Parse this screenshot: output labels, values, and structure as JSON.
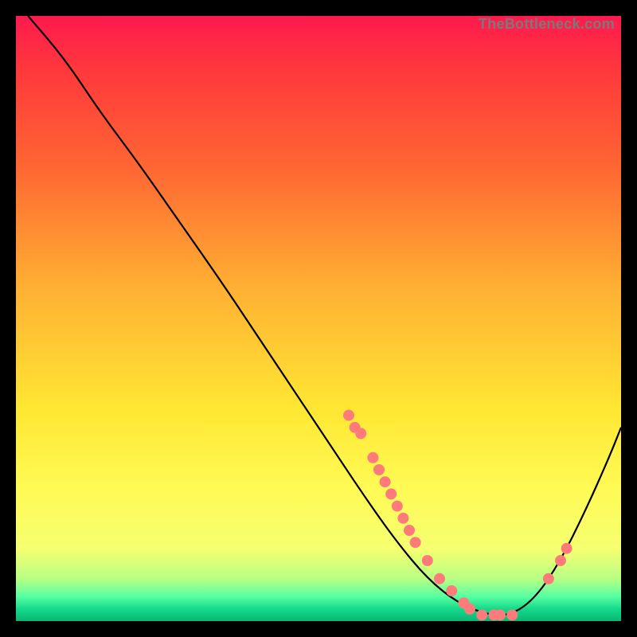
{
  "watermark": "TheBottleneck.com",
  "chart_data": {
    "type": "line",
    "title": "",
    "xlabel": "",
    "ylabel": "",
    "xlim": [
      0,
      100
    ],
    "ylim": [
      0,
      100
    ],
    "grid": false,
    "curve": [
      {
        "x": 2,
        "y": 100
      },
      {
        "x": 8,
        "y": 93
      },
      {
        "x": 14,
        "y": 84
      },
      {
        "x": 20,
        "y": 76
      },
      {
        "x": 27,
        "y": 66
      },
      {
        "x": 34,
        "y": 56
      },
      {
        "x": 40,
        "y": 47
      },
      {
        "x": 46,
        "y": 38
      },
      {
        "x": 52,
        "y": 29
      },
      {
        "x": 58,
        "y": 20
      },
      {
        "x": 63,
        "y": 13
      },
      {
        "x": 68,
        "y": 7
      },
      {
        "x": 73,
        "y": 3
      },
      {
        "x": 78,
        "y": 1
      },
      {
        "x": 82,
        "y": 1
      },
      {
        "x": 86,
        "y": 4
      },
      {
        "x": 90,
        "y": 10
      },
      {
        "x": 94,
        "y": 18
      },
      {
        "x": 98,
        "y": 27
      },
      {
        "x": 100,
        "y": 32
      }
    ],
    "points": [
      {
        "x": 55,
        "y": 34
      },
      {
        "x": 56,
        "y": 32
      },
      {
        "x": 57,
        "y": 31
      },
      {
        "x": 59,
        "y": 27
      },
      {
        "x": 60,
        "y": 25
      },
      {
        "x": 61,
        "y": 23
      },
      {
        "x": 62,
        "y": 21
      },
      {
        "x": 63,
        "y": 19
      },
      {
        "x": 64,
        "y": 17
      },
      {
        "x": 65,
        "y": 15
      },
      {
        "x": 66,
        "y": 13
      },
      {
        "x": 68,
        "y": 10
      },
      {
        "x": 70,
        "y": 7
      },
      {
        "x": 72,
        "y": 5
      },
      {
        "x": 74,
        "y": 3
      },
      {
        "x": 75,
        "y": 2
      },
      {
        "x": 77,
        "y": 1
      },
      {
        "x": 79,
        "y": 1
      },
      {
        "x": 80,
        "y": 1
      },
      {
        "x": 82,
        "y": 1
      },
      {
        "x": 88,
        "y": 7
      },
      {
        "x": 90,
        "y": 10
      },
      {
        "x": 91,
        "y": 12
      }
    ],
    "point_color": "#ff7b7b",
    "curve_color": "#000000"
  }
}
